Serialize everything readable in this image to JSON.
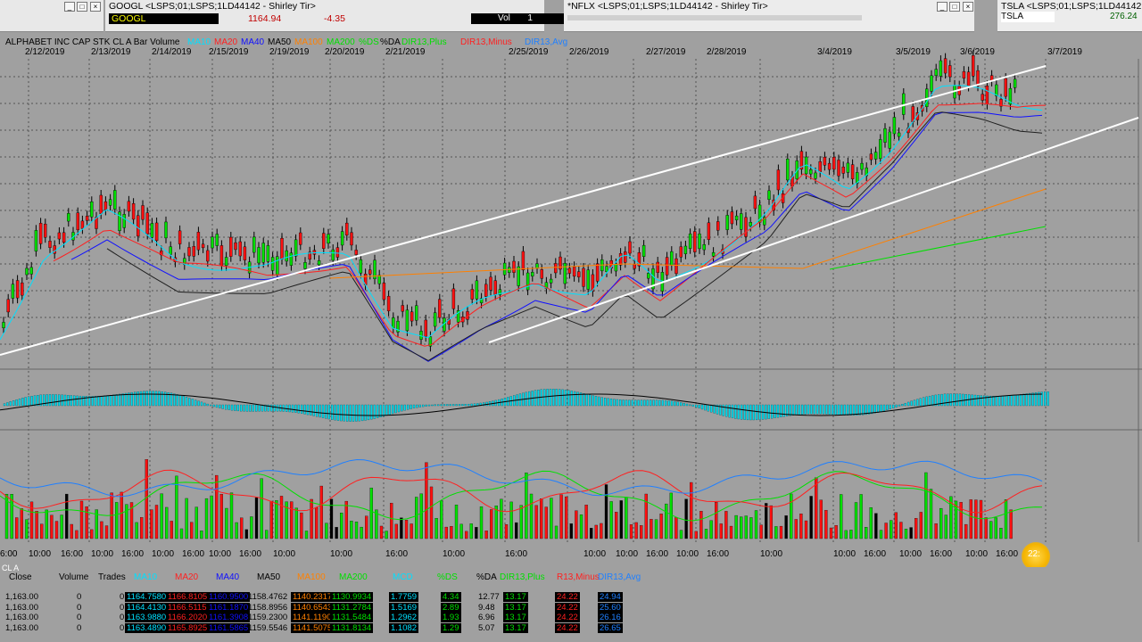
{
  "windows": [
    {
      "title": "GOOGL <LSPS;01;LSPS;1LD44142 - Shirley Tir>",
      "symbol": "GOOGL",
      "price": "1164.94",
      "change": "-4.35",
      "vol_label": "Vol",
      "vol_value": "1"
    },
    {
      "title": "*NFLX <LSPS;01;LSPS;1LD44142 - Shirley Tir>",
      "symbol": "NFLX"
    },
    {
      "title": "TSLA <LSPS;01;LSPS;1LD44142",
      "symbol": "TSLA",
      "price": "276.24"
    }
  ],
  "chart": {
    "header_text": "ALPHABET INC CAP STK CL A  Bar  Volume",
    "legend": [
      {
        "label": "MA10",
        "color": "#00e0ff"
      },
      {
        "label": "MA20",
        "color": "#ff2020"
      },
      {
        "label": "MA40",
        "color": "#1010ff"
      },
      {
        "label": "MA50",
        "color": "#000000"
      },
      {
        "label": "MA100",
        "color": "#ff8000"
      },
      {
        "label": "MA200",
        "color": "#00e000"
      },
      {
        "label": "%DS",
        "color": "#00e000"
      },
      {
        "label": "%DA",
        "color": "#000000"
      },
      {
        "label": "DIR13,Plus",
        "color": "#00e000"
      },
      {
        "label": "DIR13,Minus",
        "color": "#ff2020"
      },
      {
        "label": "DIR13,Avg",
        "color": "#2080ff"
      }
    ],
    "dates": [
      {
        "label": "2/12/2019"
      },
      {
        "label": "2/13/2019"
      },
      {
        "label": "2/14/2019"
      },
      {
        "label": "2/15/2019"
      },
      {
        "label": "2/19/2019"
      },
      {
        "label": "2/20/2019"
      },
      {
        "label": "2/21/2019"
      },
      {
        "label": "2/25/2019"
      },
      {
        "label": "2/26/2019"
      },
      {
        "label": "2/27/2019"
      },
      {
        "label": "2/28/2019"
      },
      {
        "label": "3/4/2019"
      },
      {
        "label": "3/5/2019"
      },
      {
        "label": "3/6/2019"
      },
      {
        "label": "3/7/2019"
      }
    ],
    "times": [
      "6:00",
      "10:00",
      "16:00",
      "10:00",
      "16:00",
      "10:00",
      "16:00",
      "10:00",
      "16:00",
      "10:00",
      "10:00",
      "16:00",
      "10:00",
      "16:00",
      "10:00",
      "10:00",
      "16:00",
      "10:00",
      "16:00",
      "10:00",
      "10:00",
      "16:00",
      "10:00",
      "16:00",
      "10:00",
      "16:00",
      "10:00",
      "16:00"
    ],
    "cursor_label": "22:"
  },
  "grid": {
    "symbol_label": "CL A",
    "columns": [
      {
        "label": "Close",
        "color": "#000000"
      },
      {
        "label": "Volume",
        "color": "#000000"
      },
      {
        "label": "Trades",
        "color": "#000000"
      },
      {
        "label": "MA10",
        "color": "#00e0ff"
      },
      {
        "label": "MA20",
        "color": "#ff2020"
      },
      {
        "label": "MA40",
        "color": "#1010ff"
      },
      {
        "label": "MA50",
        "color": "#000000"
      },
      {
        "label": "MA100",
        "color": "#ff8000"
      },
      {
        "label": "MA200",
        "color": "#00e000"
      },
      {
        "label": "MCD",
        "color": "#00e0ff"
      },
      {
        "label": "%DS",
        "color": "#00e000"
      },
      {
        "label": "%DA",
        "color": "#000000"
      },
      {
        "label": "DIR13,Plus",
        "color": "#00e000"
      },
      {
        "label": "R13,Minus",
        "color": "#ff2020"
      },
      {
        "label": "DIR13,Avg",
        "color": "#2080ff"
      }
    ],
    "rows": [
      [
        "1,163.00",
        "0",
        "0",
        "1164.7580",
        "1166.8105",
        "1160.9500",
        "1158.4762",
        "1140.2317",
        "1130.9934",
        "1.7759",
        "4.34",
        "12.77",
        "13.17",
        "24.22",
        "24.94"
      ],
      [
        "1,163.00",
        "0",
        "0",
        "1164.4130",
        "1166.5115",
        "1161.1870",
        "1158.8956",
        "1140.6543",
        "1131.2784",
        "1.5169",
        "2.89",
        "9.48",
        "13.17",
        "24.22",
        "25.60"
      ],
      [
        "1,163.00",
        "0",
        "0",
        "1163.9880",
        "1166.2020",
        "1161.3908",
        "1159.2300",
        "1141.1190",
        "1131.5484",
        "1.2962",
        "1.93",
        "6.96",
        "13.17",
        "24.22",
        "26.16"
      ],
      [
        "1,163.00",
        "0",
        "0",
        "1163.4890",
        "1165.8925",
        "1161.5865",
        "1159.5546",
        "1141.5075",
        "1131.8134",
        "1.1082",
        "1.29",
        "5.07",
        "13.17",
        "24.22",
        "26.65"
      ]
    ]
  }
}
